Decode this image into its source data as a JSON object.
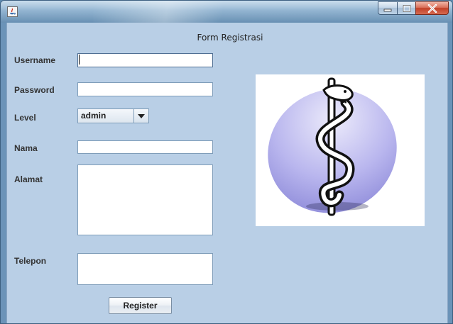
{
  "window": {
    "title": "",
    "controls": {
      "minimize_icon": "minimize-icon",
      "maximize_icon": "maximize-icon",
      "close_icon": "close-icon"
    }
  },
  "form": {
    "title": "Form Registrasi",
    "fields": {
      "username": {
        "label": "Username",
        "value": ""
      },
      "password": {
        "label": "Password",
        "value": ""
      },
      "level": {
        "label": "Level",
        "value": "admin"
      },
      "nama": {
        "label": "Nama",
        "value": ""
      },
      "alamat": {
        "label": "Alamat",
        "value": ""
      },
      "telepon": {
        "label": "Telepon",
        "value": ""
      }
    },
    "register_label": "Register"
  },
  "logo": {
    "icon": "rod-of-asclepius-icon"
  },
  "colors": {
    "panel_bg": "#b9cfe6",
    "close_button": "#c24027",
    "logo_ellipse": "#a9a6e6"
  }
}
